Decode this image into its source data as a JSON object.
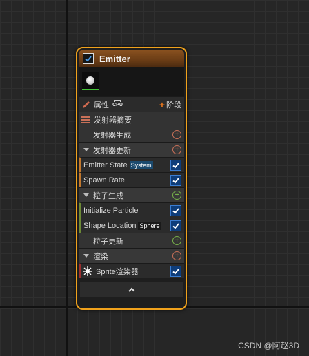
{
  "emitter": {
    "title": "Emitter",
    "properties_label": "属性",
    "cpu_badge": "CPU",
    "stage_button": "阶段",
    "summary_label": "发射器摘要",
    "emitter_spawn_label": "发射器生成",
    "emitter_update_label": "发射器更新",
    "emitter_state_label": "Emitter State",
    "emitter_state_tag": "System",
    "spawn_rate_label": "Spawn Rate",
    "particle_spawn_label": "粒子生成",
    "init_particle_label": "Initialize Particle",
    "shape_location_label": "Shape Location",
    "shape_location_tag": "Sphere",
    "particle_update_label": "粒子更新",
    "render_label": "渲染",
    "sprite_renderer_label": "Sprite渲染器",
    "collapse_icon": "chevron-up-icon"
  },
  "watermark": "CSDN @阿赵3D",
  "colors": {
    "node_border": "#f0a21c",
    "checkbox_blue": "#0e3d7a",
    "plus_orange": "#c97058",
    "plus_green": "#77b04a"
  }
}
